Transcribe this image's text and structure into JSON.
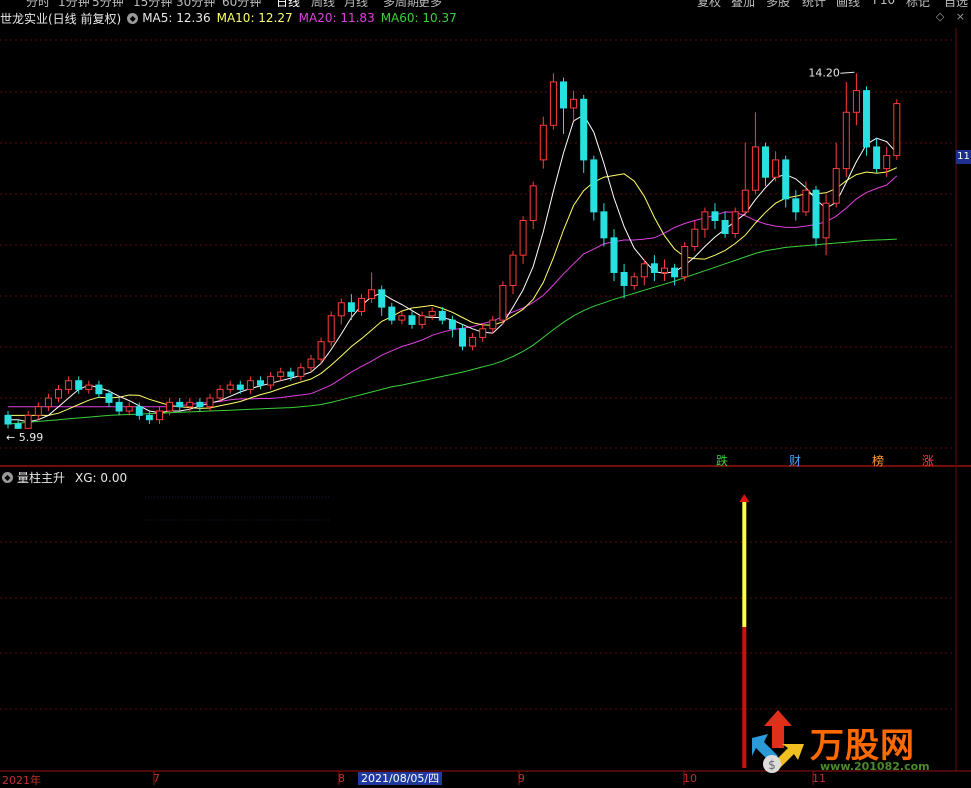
{
  "top_menu": [
    "分时",
    "1分钟",
    "5分钟",
    "15分钟",
    "30分钟",
    "60分钟",
    "日线",
    "周线",
    "月线",
    "多周期",
    "更多",
    "复权",
    "叠加",
    "多股",
    "统计",
    "画线",
    "F10",
    "标记",
    "自选"
  ],
  "legend": {
    "title": "世龙实业(日线 前复权)",
    "ma5": "MA5: 12.36",
    "ma10": "MA10: 12.27",
    "ma20": "MA20: 11.83",
    "ma60": "MA60: 10.37"
  },
  "labels": {
    "high": "14.20",
    "low": "5.99",
    "side_price": "11"
  },
  "badges": [
    "跌",
    "财",
    "榜",
    "涨"
  ],
  "sub_legend": {
    "title": "量柱主升",
    "xg": "XG: 0.00"
  },
  "xaxis": {
    "year": "2021年",
    "m7": "7",
    "m8": "8",
    "date": "2021/08/05/四",
    "m9": "9",
    "m10": "10",
    "m11": "11"
  },
  "watermark": {
    "name": "万股网",
    "url": "www.201082.com"
  },
  "colors": {
    "up": "#ff3b3b",
    "down": "#28e0e0",
    "ma5": "#ffffff",
    "ma10": "#ffff66",
    "ma20": "#e040e0",
    "ma60": "#3ad13a",
    "signal_yellow": "#ffff44",
    "signal_red": "#cc1111"
  },
  "chart_data": {
    "type": "candlestick",
    "ylim": [
      5.5,
      15.2
    ],
    "candles": [
      [
        6.3,
        6.1,
        6.4,
        6.0
      ],
      [
        6.1,
        6.0,
        6.2,
        5.99
      ],
      [
        6.0,
        6.3,
        6.4,
        5.99
      ],
      [
        6.3,
        6.5,
        6.6,
        6.2
      ],
      [
        6.5,
        6.7,
        6.8,
        6.4
      ],
      [
        6.7,
        6.9,
        7.0,
        6.6
      ],
      [
        6.9,
        7.1,
        7.2,
        6.8
      ],
      [
        7.1,
        6.9,
        7.2,
        6.8
      ],
      [
        6.9,
        7.0,
        7.1,
        6.8
      ],
      [
        7.0,
        6.8,
        7.1,
        6.7
      ],
      [
        6.8,
        6.6,
        6.9,
        6.5
      ],
      [
        6.6,
        6.4,
        6.7,
        6.3
      ],
      [
        6.4,
        6.5,
        6.6,
        6.3
      ],
      [
        6.5,
        6.3,
        6.6,
        6.2
      ],
      [
        6.3,
        6.2,
        6.4,
        6.1
      ],
      [
        6.2,
        6.4,
        6.5,
        6.1
      ],
      [
        6.4,
        6.6,
        6.7,
        6.3
      ],
      [
        6.6,
        6.5,
        6.7,
        6.4
      ],
      [
        6.5,
        6.6,
        6.7,
        6.4
      ],
      [
        6.6,
        6.5,
        6.7,
        6.4
      ],
      [
        6.5,
        6.7,
        6.8,
        6.4
      ],
      [
        6.7,
        6.9,
        7.0,
        6.6
      ],
      [
        6.9,
        7.0,
        7.1,
        6.8
      ],
      [
        7.0,
        6.9,
        7.1,
        6.8
      ],
      [
        6.9,
        7.1,
        7.2,
        6.8
      ],
      [
        7.1,
        7.0,
        7.2,
        6.9
      ],
      [
        7.0,
        7.2,
        7.3,
        6.9
      ],
      [
        7.2,
        7.3,
        7.4,
        7.1
      ],
      [
        7.3,
        7.2,
        7.4,
        7.1
      ],
      [
        7.2,
        7.4,
        7.5,
        7.1
      ],
      [
        7.4,
        7.6,
        7.7,
        7.3
      ],
      [
        7.6,
        8.0,
        8.1,
        7.5
      ],
      [
        8.0,
        8.6,
        8.7,
        7.9
      ],
      [
        8.6,
        8.9,
        9.0,
        8.4
      ],
      [
        8.9,
        8.7,
        9.1,
        8.5
      ],
      [
        8.7,
        9.0,
        9.1,
        8.6
      ],
      [
        9.0,
        9.2,
        9.6,
        8.9
      ],
      [
        9.2,
        8.8,
        9.3,
        8.6
      ],
      [
        8.8,
        8.5,
        8.9,
        8.4
      ],
      [
        8.5,
        8.6,
        8.7,
        8.4
      ],
      [
        8.6,
        8.4,
        8.7,
        8.3
      ],
      [
        8.4,
        8.6,
        8.7,
        8.3
      ],
      [
        8.6,
        8.7,
        8.8,
        8.5
      ],
      [
        8.7,
        8.5,
        8.8,
        8.4
      ],
      [
        8.5,
        8.3,
        8.6,
        8.1
      ],
      [
        8.3,
        7.9,
        8.4,
        7.8
      ],
      [
        7.9,
        8.1,
        8.2,
        7.8
      ],
      [
        8.1,
        8.3,
        8.4,
        8.0
      ],
      [
        8.3,
        8.5,
        8.6,
        8.2
      ],
      [
        8.5,
        9.3,
        9.4,
        8.4
      ],
      [
        9.3,
        10.0,
        10.1,
        9.1
      ],
      [
        10.0,
        10.8,
        10.9,
        9.8
      ],
      [
        10.8,
        11.6,
        11.7,
        10.6
      ],
      [
        12.2,
        13.0,
        13.2,
        12.0
      ],
      [
        13.0,
        14.0,
        14.2,
        12.9
      ],
      [
        14.0,
        13.4,
        14.1,
        12.8
      ],
      [
        13.4,
        13.6,
        13.8,
        13.1
      ],
      [
        13.6,
        12.2,
        13.7,
        11.9
      ],
      [
        12.2,
        11.0,
        12.3,
        10.8
      ],
      [
        11.0,
        10.4,
        11.2,
        10.2
      ],
      [
        10.4,
        9.6,
        10.6,
        9.4
      ],
      [
        9.6,
        9.3,
        9.8,
        9.0
      ],
      [
        9.3,
        9.5,
        9.6,
        9.2
      ],
      [
        9.5,
        9.8,
        9.9,
        9.3
      ],
      [
        9.8,
        9.6,
        10.0,
        9.4
      ],
      [
        9.6,
        9.7,
        9.9,
        9.4
      ],
      [
        9.7,
        9.5,
        9.8,
        9.3
      ],
      [
        9.5,
        10.2,
        10.3,
        9.4
      ],
      [
        10.2,
        10.6,
        10.8,
        10.1
      ],
      [
        10.6,
        11.0,
        11.1,
        10.4
      ],
      [
        11.0,
        10.8,
        11.2,
        10.6
      ],
      [
        10.8,
        10.5,
        11.0,
        10.4
      ],
      [
        10.5,
        11.0,
        11.1,
        10.4
      ],
      [
        11.0,
        11.5,
        12.6,
        10.9
      ],
      [
        11.5,
        12.5,
        13.3,
        11.4
      ],
      [
        12.5,
        11.8,
        12.6,
        11.6
      ],
      [
        11.8,
        12.2,
        12.4,
        11.7
      ],
      [
        12.2,
        11.3,
        12.3,
        11.1
      ],
      [
        11.3,
        11.0,
        11.5,
        10.8
      ],
      [
        11.0,
        11.5,
        11.7,
        10.9
      ],
      [
        11.5,
        10.4,
        11.6,
        10.2
      ],
      [
        10.4,
        11.2,
        11.4,
        10.0
      ],
      [
        11.2,
        12.0,
        12.6,
        11.1
      ],
      [
        12.0,
        13.3,
        14.0,
        11.8
      ],
      [
        13.3,
        13.8,
        14.2,
        13.0
      ],
      [
        13.8,
        12.5,
        13.9,
        12.3
      ],
      [
        12.5,
        12.0,
        12.7,
        11.9
      ],
      [
        12.0,
        12.3,
        12.5,
        11.8
      ],
      [
        12.3,
        13.5,
        13.6,
        12.2
      ]
    ],
    "ma5": [
      6.2,
      6.2,
      6.15,
      6.2,
      6.3,
      6.5,
      6.7,
      6.9,
      7.0,
      6.94,
      6.86,
      6.74,
      6.64,
      6.52,
      6.4,
      6.36,
      6.4,
      6.4,
      6.44,
      6.52,
      6.58,
      6.64,
      6.74,
      6.84,
      6.92,
      6.98,
      7.04,
      7.1,
      7.16,
      7.22,
      7.3,
      7.5,
      7.82,
      8.18,
      8.56,
      8.84,
      9.04,
      9.12,
      8.98,
      8.86,
      8.72,
      8.58,
      8.56,
      8.56,
      8.5,
      8.4,
      8.3,
      8.22,
      8.2,
      8.42,
      8.8,
      9.2,
      9.74,
      10.54,
      11.48,
      12.36,
      13.1,
      13.24,
      12.84,
      12.12,
      11.32,
      10.66,
      10.16,
      9.88,
      9.62,
      9.58,
      9.62,
      9.76,
      9.96,
      10.2,
      10.42,
      10.6,
      10.78,
      10.96,
      11.28,
      11.56,
      11.8,
      11.86,
      11.76,
      11.56,
      11.28,
      11.08,
      11.22,
      11.68,
      12.16,
      12.56,
      12.7,
      12.62,
      12.36
    ],
    "ma10": [
      6.3,
      6.3,
      6.3,
      6.3,
      6.3,
      6.35,
      6.45,
      6.55,
      6.65,
      6.72,
      6.7,
      6.72,
      6.77,
      6.76,
      6.67,
      6.6,
      6.53,
      6.5,
      6.48,
      6.46,
      6.47,
      6.52,
      6.57,
      6.62,
      6.7,
      6.78,
      6.84,
      6.92,
      7.0,
      7.07,
      7.14,
      7.27,
      7.46,
      7.67,
      7.89,
      8.07,
      8.27,
      8.47,
      8.58,
      8.71,
      8.78,
      8.81,
      8.84,
      8.77,
      8.68,
      8.56,
      8.44,
      8.39,
      8.38,
      8.46,
      8.6,
      8.75,
      8.98,
      9.37,
      9.94,
      10.58,
      11.15,
      11.49,
      11.69,
      11.8,
      11.84,
      11.88,
      11.71,
      11.36,
      10.87,
      10.45,
      10.14,
      9.96,
      9.92,
      9.91,
      10.0,
      10.11,
      10.27,
      10.46,
      10.74,
      10.99,
      11.2,
      11.32,
      11.36,
      11.42,
      11.42,
      11.44,
      11.54,
      11.72,
      11.86,
      11.92,
      11.89,
      11.92,
      12.02
    ],
    "ma20": [
      6.5,
      6.5,
      6.5,
      6.5,
      6.5,
      6.5,
      6.5,
      6.5,
      6.5,
      6.5,
      6.5,
      6.5,
      6.5,
      6.5,
      6.5,
      6.5,
      6.5,
      6.52,
      6.55,
      6.58,
      6.6,
      6.62,
      6.66,
      6.68,
      6.68,
      6.69,
      6.69,
      6.71,
      6.74,
      6.77,
      6.8,
      6.9,
      7.0,
      7.15,
      7.3,
      7.43,
      7.55,
      7.69,
      7.79,
      7.89,
      7.96,
      8.04,
      8.15,
      8.22,
      8.28,
      8.31,
      8.35,
      8.42,
      8.48,
      8.58,
      8.69,
      8.78,
      8.91,
      9.07,
      9.31,
      9.57,
      9.8,
      10.03,
      10.14,
      10.26,
      10.31,
      10.35,
      10.35,
      10.37,
      10.4,
      10.51,
      10.64,
      10.73,
      10.8,
      10.86,
      10.92,
      11.0,
      10.99,
      10.91,
      10.8,
      10.72,
      10.67,
      10.64,
      10.64,
      10.67,
      10.71,
      10.77,
      10.9,
      11.09,
      11.3,
      11.45,
      11.54,
      11.62,
      11.83
    ],
    "ma60": [
      6.1,
      6.12,
      6.14,
      6.16,
      6.18,
      6.2,
      6.22,
      6.24,
      6.26,
      6.28,
      6.3,
      6.31,
      6.32,
      6.33,
      6.34,
      6.35,
      6.36,
      6.37,
      6.38,
      6.39,
      6.4,
      6.41,
      6.42,
      6.43,
      6.44,
      6.45,
      6.46,
      6.47,
      6.48,
      6.5,
      6.52,
      6.55,
      6.6,
      6.66,
      6.72,
      6.78,
      6.84,
      6.9,
      6.96,
      7.0,
      7.05,
      7.1,
      7.15,
      7.2,
      7.25,
      7.3,
      7.36,
      7.42,
      7.48,
      7.56,
      7.66,
      7.78,
      7.92,
      8.1,
      8.28,
      8.45,
      8.6,
      8.72,
      8.82,
      8.9,
      8.98,
      9.05,
      9.12,
      9.19,
      9.26,
      9.33,
      9.4,
      9.48,
      9.56,
      9.64,
      9.72,
      9.8,
      9.88,
      9.96,
      10.04,
      10.1,
      10.14,
      10.18,
      10.2,
      10.22,
      10.24,
      10.26,
      10.28,
      10.3,
      10.32,
      10.34,
      10.35,
      10.36,
      10.37
    ],
    "signal": {
      "index": 73,
      "red_to": 0.0,
      "value_frac_yellow": 0.57,
      "total_frac": 1.0
    }
  }
}
